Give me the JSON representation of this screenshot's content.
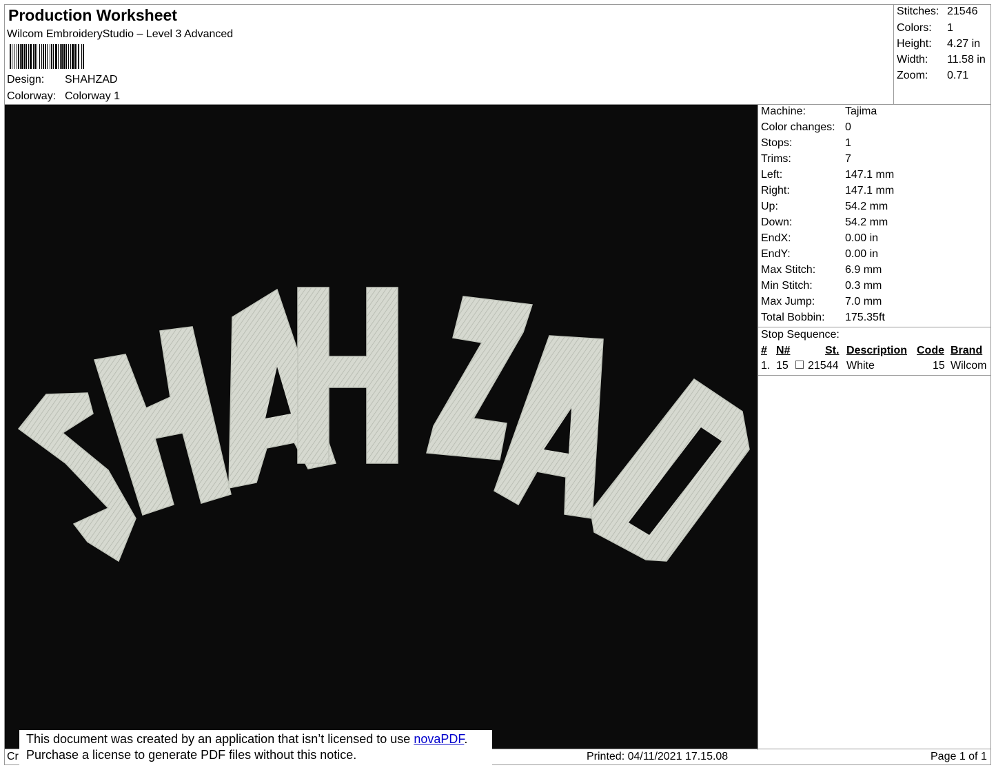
{
  "header": {
    "title": "Production Worksheet",
    "subtitle": "Wilcom EmbroideryStudio – Level 3 Advanced",
    "design_label": "Design:",
    "design_value": "SHAHZAD",
    "colorway_label": "Colorway:",
    "colorway_value": "Colorway 1"
  },
  "summary": [
    {
      "label": "Stitches:",
      "value": "21546"
    },
    {
      "label": "Colors:",
      "value": "1"
    },
    {
      "label": "Height:",
      "value": "4.27 in"
    },
    {
      "label": "Width:",
      "value": "11.58 in"
    },
    {
      "label": "Zoom:",
      "value": "0.71"
    }
  ],
  "machine_info": [
    {
      "label": "Machine:",
      "value": "Tajima"
    },
    {
      "label": "Color changes:",
      "value": "0"
    },
    {
      "label": "Stops:",
      "value": "1"
    },
    {
      "label": "Trims:",
      "value": "7"
    },
    {
      "label": "Left:",
      "value": "147.1 mm"
    },
    {
      "label": "Right:",
      "value": "147.1 mm"
    },
    {
      "label": "Up:",
      "value": "54.2 mm"
    },
    {
      "label": "Down:",
      "value": "54.2 mm"
    },
    {
      "label": "EndX:",
      "value": "0.00 in"
    },
    {
      "label": "EndY:",
      "value": "0.00 in"
    },
    {
      "label": "Max Stitch:",
      "value": "6.9 mm"
    },
    {
      "label": "Min Stitch:",
      "value": "0.3 mm"
    },
    {
      "label": "Max Jump:",
      "value": "7.0 mm"
    },
    {
      "label": "Total Bobbin:",
      "value": "175.35ft"
    }
  ],
  "stop_sequence": {
    "title": "Stop Sequence:",
    "headers": {
      "num": "#",
      "n": "N#",
      "st": "St.",
      "description": "Description",
      "code": "Code",
      "brand": "Brand"
    },
    "rows": [
      {
        "num": "1.",
        "n": "15",
        "st": "21544",
        "description": "White",
        "code": "15",
        "brand": "Wilcom"
      }
    ]
  },
  "design_preview": {
    "text": "SHAHZAD",
    "background_color": "#0b0b0b",
    "thread_color": "#d6d9d0"
  },
  "notice": {
    "line1_before": "This document was created by an application that isn’t licensed to use ",
    "link_text": "novaPDF",
    "line1_after": ".",
    "line2": "Purchase a license to generate PDF files without this notice."
  },
  "footer": {
    "left_fragment": "Cr",
    "printed": "Printed: 04/11/2021 17.15.08",
    "page": "Page 1 of 1"
  }
}
